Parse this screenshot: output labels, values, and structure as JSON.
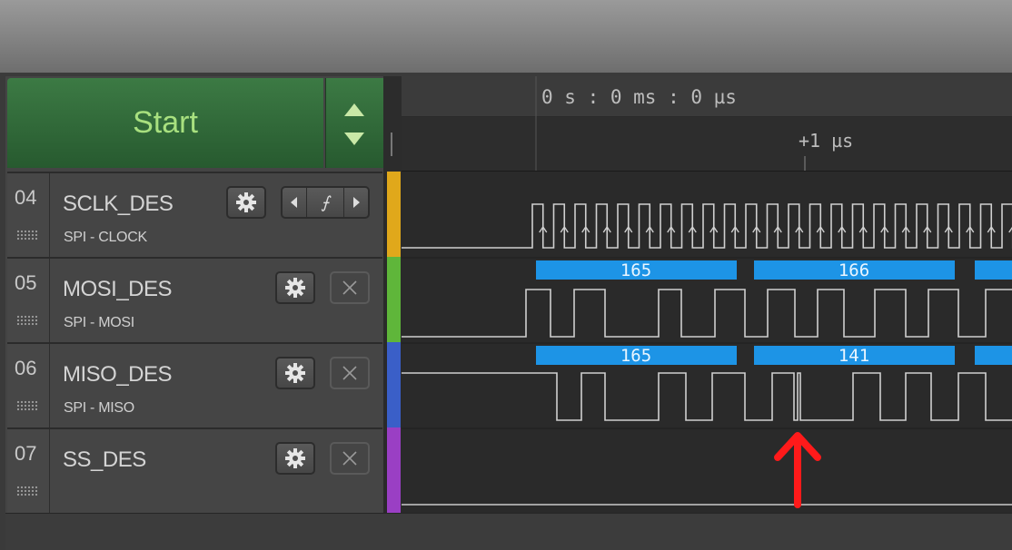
{
  "start_button": {
    "label": "Start"
  },
  "timeline": {
    "time_label": "0 s : 0 ms : 0 µs",
    "tick_label": "+1 µs"
  },
  "channels": [
    {
      "number": "04",
      "name": "SCLK_DES",
      "subtitle": "SPI - CLOCK",
      "color": "#e0a81b",
      "trigger_symbol": "⨍"
    },
    {
      "number": "05",
      "name": "MOSI_DES",
      "subtitle": "SPI - MOSI",
      "color": "#5fb63a"
    },
    {
      "number": "06",
      "name": "MISO_DES",
      "subtitle": "SPI - MISO",
      "color": "#3a5fc8"
    },
    {
      "number": "07",
      "name": "SS_DES",
      "subtitle": "",
      "color": "#9a3fc4"
    }
  ],
  "mosi_decodes": [
    "165",
    "166"
  ],
  "miso_decodes": [
    "165",
    "141"
  ],
  "colors": {
    "decode_bar": "#1d94e6",
    "annotation_arrow": "#ff1a1a"
  },
  "icons": {
    "settings": "gear-icon",
    "remove": "close-icon",
    "prev": "chevron-left-icon",
    "next": "chevron-right-icon",
    "sort_up": "triangle-up-icon",
    "sort_down": "triangle-down-icon"
  }
}
